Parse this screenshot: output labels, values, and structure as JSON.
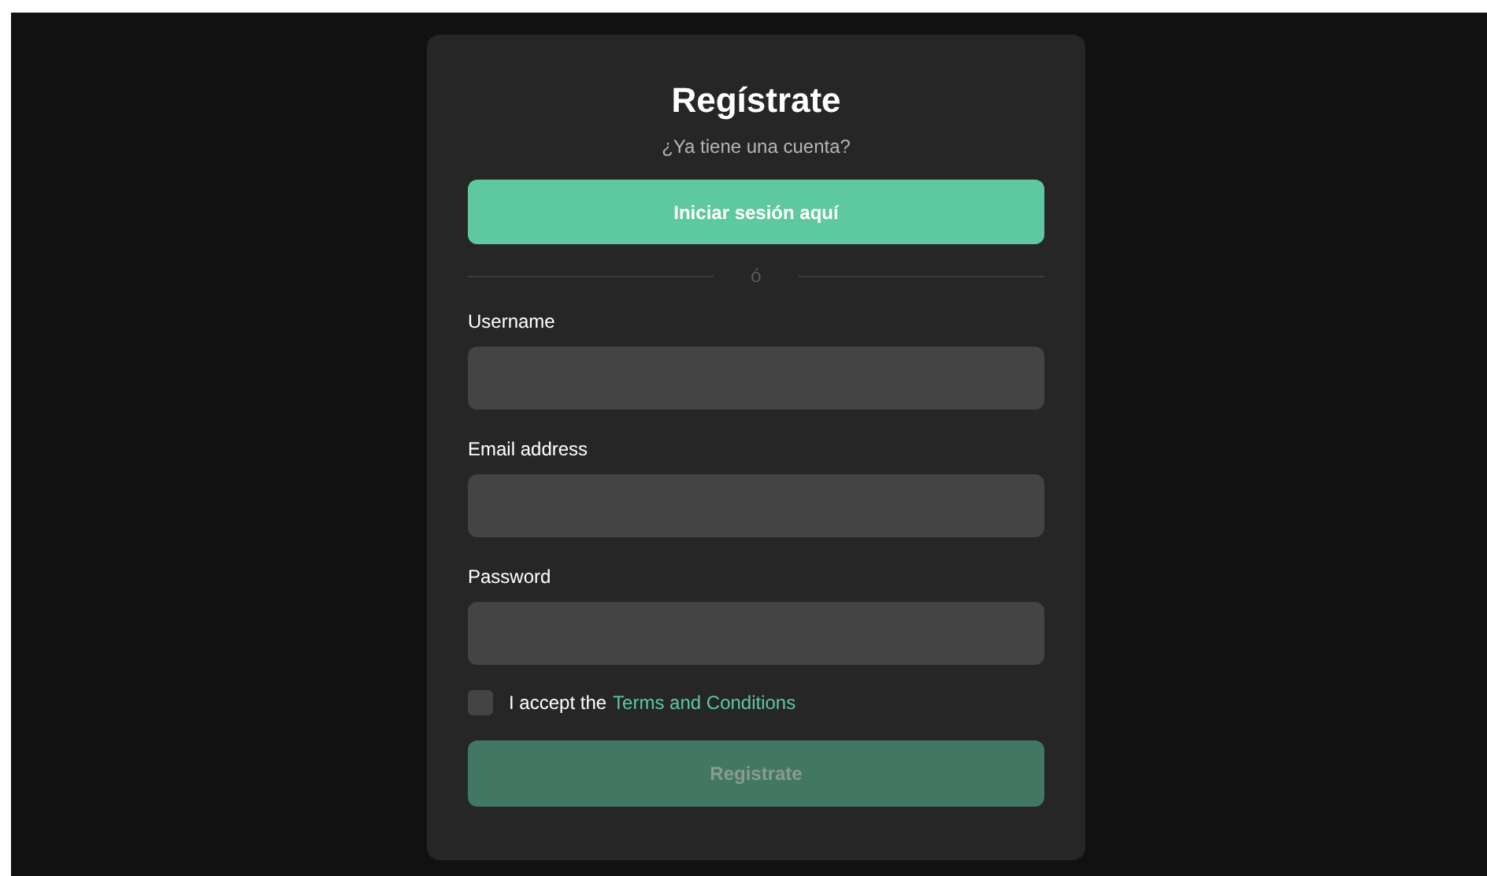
{
  "title": "Regístrate",
  "subtitle": "¿Ya tiene una cuenta?",
  "login_button": {
    "label": "Iniciar sesión aquí"
  },
  "divider": {
    "label": "ó"
  },
  "fields": [
    {
      "label": "Username"
    },
    {
      "label": "Email address"
    },
    {
      "label": "Password"
    }
  ],
  "terms": {
    "text": "I accept the",
    "link": "Terms and Conditions",
    "checked": false
  },
  "submit_button": {
    "label": "Registrate",
    "disabled": true
  }
}
